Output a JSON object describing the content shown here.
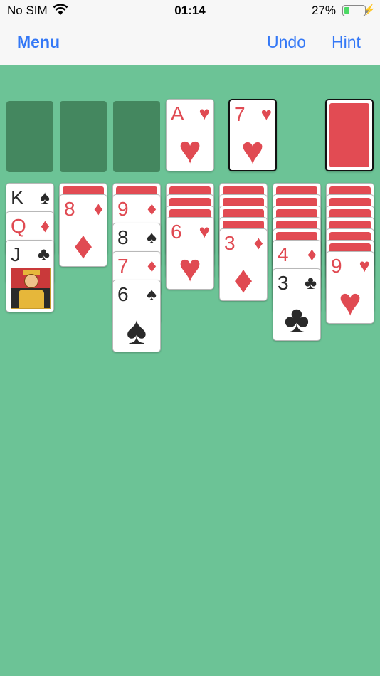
{
  "status": {
    "carrier": "No SIM",
    "time": "01:14",
    "battery": "27%",
    "battery_level": 0.27
  },
  "nav": {
    "menu": "Menu",
    "undo": "Undo",
    "hint": "Hint"
  },
  "foundations": [
    {
      "rank": "A",
      "suit": "♥",
      "color": "red"
    }
  ],
  "waste": {
    "rank": "7",
    "suit": "♥",
    "color": "red"
  },
  "tableau": [
    {
      "hidden": 0,
      "cards": [
        {
          "rank": "K",
          "suit": "♠",
          "color": "black"
        },
        {
          "rank": "Q",
          "suit": "♦",
          "color": "red"
        },
        {
          "rank": "J",
          "suit": "♣",
          "color": "black",
          "face": true
        }
      ]
    },
    {
      "hidden": 1,
      "cards": [
        {
          "rank": "8",
          "suit": "♦",
          "color": "red"
        }
      ]
    },
    {
      "hidden": 1,
      "cards": [
        {
          "rank": "9",
          "suit": "♦",
          "color": "red"
        },
        {
          "rank": "8",
          "suit": "♠",
          "color": "black"
        },
        {
          "rank": "7",
          "suit": "♦",
          "color": "red"
        },
        {
          "rank": "6",
          "suit": "♠",
          "color": "black"
        }
      ]
    },
    {
      "hidden": 3,
      "cards": [
        {
          "rank": "6",
          "suit": "♥",
          "color": "red"
        }
      ]
    },
    {
      "hidden": 4,
      "cards": [
        {
          "rank": "3",
          "suit": "♦",
          "color": "red"
        }
      ]
    },
    {
      "hidden": 5,
      "cards": [
        {
          "rank": "4",
          "suit": "♦",
          "color": "red"
        },
        {
          "rank": "3",
          "suit": "♣",
          "color": "black"
        }
      ]
    },
    {
      "hidden": 6,
      "cards": [
        {
          "rank": "9",
          "suit": "♥",
          "color": "red"
        }
      ]
    }
  ]
}
